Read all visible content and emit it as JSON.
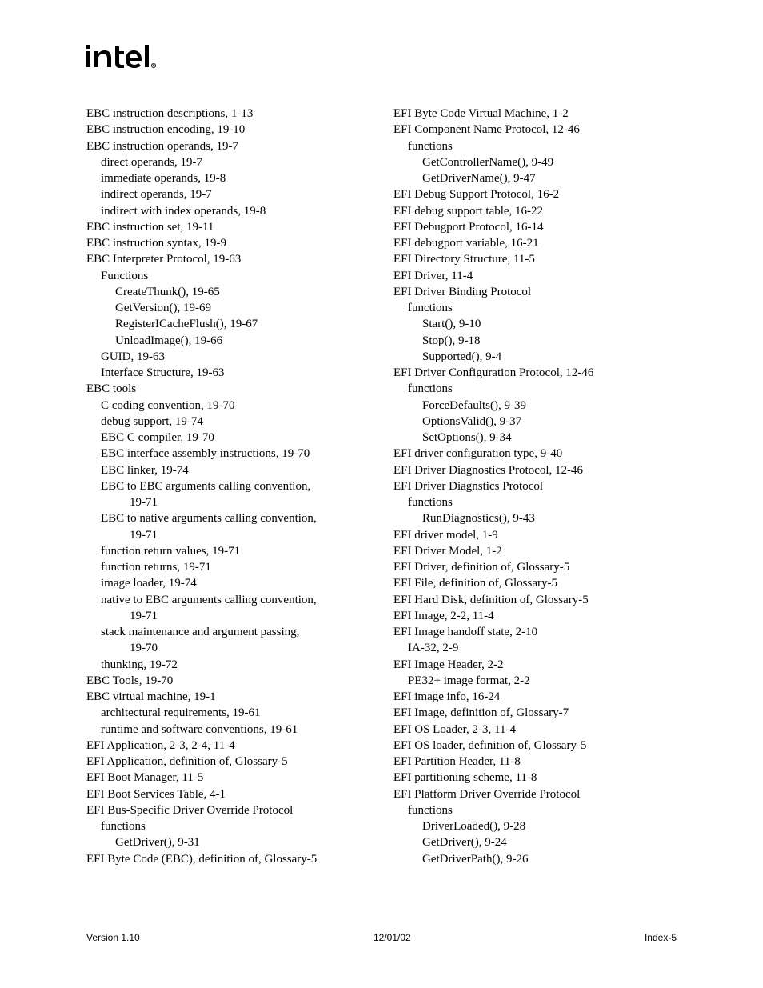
{
  "logo_alt": "intel",
  "footer": {
    "left": "Version 1.10",
    "center": "12/01/02",
    "right": "Index-5"
  },
  "left_col": [
    {
      "t": "EBC instruction descriptions, 1-13",
      "i": 0
    },
    {
      "t": "EBC instruction encoding, 19-10",
      "i": 0
    },
    {
      "t": "EBC instruction operands, 19-7",
      "i": 0
    },
    {
      "t": "direct operands, 19-7",
      "i": 1
    },
    {
      "t": "immediate operands, 19-8",
      "i": 1
    },
    {
      "t": "indirect operands, 19-7",
      "i": 1
    },
    {
      "t": "indirect with index operands, 19-8",
      "i": 1
    },
    {
      "t": "EBC instruction set, 19-11",
      "i": 0
    },
    {
      "t": "EBC instruction syntax, 19-9",
      "i": 0
    },
    {
      "t": "EBC Interpreter Protocol, 19-63",
      "i": 0
    },
    {
      "t": "Functions",
      "i": 1
    },
    {
      "t": "CreateThunk(), 19-65",
      "i": 2
    },
    {
      "t": "GetVersion(), 19-69",
      "i": 2
    },
    {
      "t": "RegisterICacheFlush(), 19-67",
      "i": 2
    },
    {
      "t": "UnloadImage(), 19-66",
      "i": 2
    },
    {
      "t": "GUID, 19-63",
      "i": 1
    },
    {
      "t": "Interface Structure, 19-63",
      "i": 1
    },
    {
      "t": "EBC tools",
      "i": 0
    },
    {
      "t": "C coding convention, 19-70",
      "i": 1
    },
    {
      "t": "debug support, 19-74",
      "i": 1
    },
    {
      "t": "EBC C compiler, 19-70",
      "i": 1
    },
    {
      "t": "EBC interface assembly instructions, 19-70",
      "i": 1
    },
    {
      "t": "EBC linker, 19-74",
      "i": 1
    },
    {
      "t": "EBC to EBC arguments calling convention, ",
      "i": 1
    },
    {
      "t": "19-71",
      "i": 3
    },
    {
      "t": "EBC to native arguments calling convention, ",
      "i": 1
    },
    {
      "t": "19-71",
      "i": 3
    },
    {
      "t": "function return values, 19-71",
      "i": 1
    },
    {
      "t": "function returns, 19-71",
      "i": 1
    },
    {
      "t": "image loader, 19-74",
      "i": 1
    },
    {
      "t": "native to EBC arguments calling convention, ",
      "i": 1
    },
    {
      "t": "19-71",
      "i": 3
    },
    {
      "t": "stack maintenance and argument passing, ",
      "i": 1
    },
    {
      "t": "19-70",
      "i": 3
    },
    {
      "t": "thunking, 19-72",
      "i": 1
    },
    {
      "t": "EBC Tools, 19-70",
      "i": 0
    },
    {
      "t": "EBC virtual machine, 19-1",
      "i": 0
    },
    {
      "t": "architectural requirements, 19-61",
      "i": 1
    },
    {
      "t": "runtime and software conventions, 19-61",
      "i": 1
    },
    {
      "t": "EFI Application, 2-3, 2-4, 11-4",
      "i": 0
    },
    {
      "t": "EFI Application, definition of, Glossary-5",
      "i": 0
    },
    {
      "t": "EFI Boot Manager, 11-5",
      "i": 0
    },
    {
      "t": "EFI Boot Services Table, 4-1",
      "i": 0
    },
    {
      "t": "EFI Bus-Specific Driver Override Protocol",
      "i": 0
    },
    {
      "t": "functions",
      "i": 1
    },
    {
      "t": "GetDriver(), 9-31",
      "i": 2
    },
    {
      "t": "EFI Byte Code (EBC), definition of, Glossary-5",
      "i": 0
    }
  ],
  "right_col": [
    {
      "t": "EFI Byte Code Virtual Machine, 1-2",
      "i": 0
    },
    {
      "t": "EFI Component Name Protocol, 12-46",
      "i": 0
    },
    {
      "t": "functions",
      "i": 1
    },
    {
      "t": "GetControllerName(), 9-49",
      "i": 2
    },
    {
      "t": "GetDriverName(), 9-47",
      "i": 2
    },
    {
      "t": "EFI Debug Support Protocol, 16-2",
      "i": 0
    },
    {
      "t": "EFI debug support table, 16-22",
      "i": 0
    },
    {
      "t": "EFI Debugport Protocol, 16-14",
      "i": 0
    },
    {
      "t": "EFI debugport variable, 16-21",
      "i": 0
    },
    {
      "t": "EFI Directory Structure, 11-5",
      "i": 0
    },
    {
      "t": "EFI Driver, 11-4",
      "i": 0
    },
    {
      "t": "EFI Driver Binding Protocol",
      "i": 0
    },
    {
      "t": "functions",
      "i": 1
    },
    {
      "t": "Start(), 9-10",
      "i": 2
    },
    {
      "t": "Stop(), 9-18",
      "i": 2
    },
    {
      "t": "Supported(), 9-4",
      "i": 2
    },
    {
      "t": "EFI Driver Configuration Protocol, 12-46",
      "i": 0
    },
    {
      "t": "functions",
      "i": 1
    },
    {
      "t": "ForceDefaults(), 9-39",
      "i": 2
    },
    {
      "t": "OptionsValid(), 9-37",
      "i": 2
    },
    {
      "t": "SetOptions(), 9-34",
      "i": 2
    },
    {
      "t": "EFI driver configuration type, 9-40",
      "i": 0
    },
    {
      "t": "EFI Driver Diagnostics Protocol, 12-46",
      "i": 0
    },
    {
      "t": "EFI Driver Diagnstics Protocol",
      "i": 0
    },
    {
      "t": "functions",
      "i": 1
    },
    {
      "t": "RunDiagnostics(), 9-43",
      "i": 2
    },
    {
      "t": "EFI driver model, 1-9",
      "i": 0
    },
    {
      "t": "EFI Driver Model, 1-2",
      "i": 0
    },
    {
      "t": "EFI Driver, definition of, Glossary-5",
      "i": 0
    },
    {
      "t": "EFI File, definition of, Glossary-5",
      "i": 0
    },
    {
      "t": "EFI Hard Disk, definition of, Glossary-5",
      "i": 0
    },
    {
      "t": "EFI Image, 2-2, 11-4",
      "i": 0
    },
    {
      "t": "EFI Image handoff state, 2-10",
      "i": 0
    },
    {
      "t": "IA-32, 2-9",
      "i": 1
    },
    {
      "t": "EFI Image Header, 2-2",
      "i": 0
    },
    {
      "t": "PE32+ image format, 2-2",
      "i": 1
    },
    {
      "t": "EFI image info, 16-24",
      "i": 0
    },
    {
      "t": "EFI Image, definition of, Glossary-7",
      "i": 0
    },
    {
      "t": "EFI OS Loader, 2-3, 11-4",
      "i": 0
    },
    {
      "t": "EFI OS loader, definition of, Glossary-5",
      "i": 0
    },
    {
      "t": "EFI Partition Header, 11-8",
      "i": 0
    },
    {
      "t": "EFI partitioning scheme, 11-8",
      "i": 0
    },
    {
      "t": "EFI Platform Driver Override Protocol",
      "i": 0
    },
    {
      "t": "functions",
      "i": 1
    },
    {
      "t": "DriverLoaded(), 9-28",
      "i": 2
    },
    {
      "t": "GetDriver(), 9-24",
      "i": 2
    },
    {
      "t": "GetDriverPath(), 9-26",
      "i": 2
    }
  ]
}
